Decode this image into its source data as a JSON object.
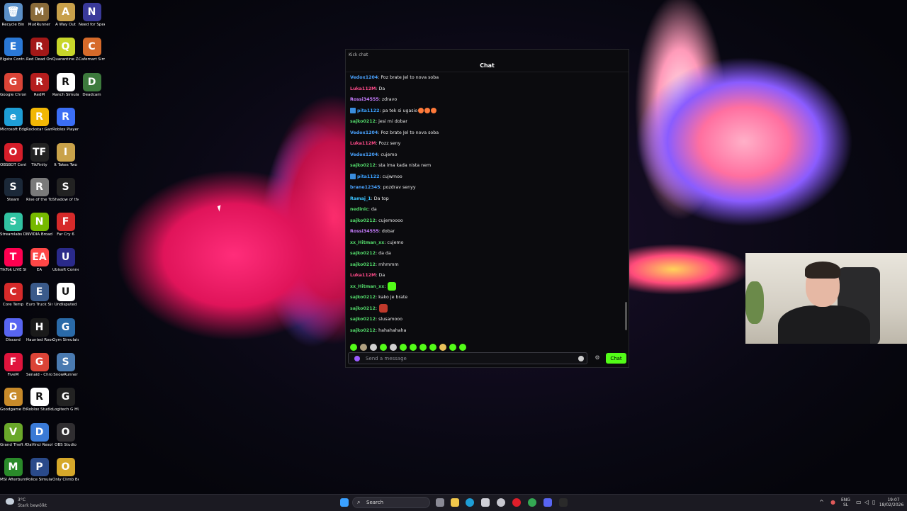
{
  "desktop_icons": [
    {
      "label": "Recycle Bin",
      "icon": "recycle-bin-icon",
      "color": "#5b8fc7",
      "glyph": "🗑"
    },
    {
      "label": "MudRunner",
      "icon": "mudrunner-icon",
      "color": "#8a6b3a",
      "glyph": "M"
    },
    {
      "label": "A Way Out",
      "icon": "a-way-out-icon",
      "color": "#c8a04a",
      "glyph": "A"
    },
    {
      "label": "Need for Speed™ Heat",
      "icon": "nfs-heat-icon",
      "color": "#3a3a9a",
      "glyph": "N"
    },
    {
      "label": "Elgato Contr...",
      "icon": "elgato-icon",
      "color": "#2a78d6",
      "glyph": "E"
    },
    {
      "label": "Red Dead Online",
      "icon": "red-dead-online-icon",
      "color": "#a31818",
      "glyph": "R"
    },
    {
      "label": "Quarantine Zone The...",
      "icon": "quarantine-zone-icon",
      "color": "#c8d62a",
      "glyph": "Q"
    },
    {
      "label": "Cafemart Simulator",
      "icon": "cafemart-icon",
      "color": "#d66a2a",
      "glyph": "C"
    },
    {
      "label": "Google Chrome",
      "icon": "chrome-icon",
      "color": "#db4437",
      "glyph": "G"
    },
    {
      "label": "RedM",
      "icon": "redm-icon",
      "color": "#b51e1e",
      "glyph": "R"
    },
    {
      "label": "Ranch Simulator",
      "icon": "ranch-simulator-icon",
      "color": "#ffffff",
      "glyph": "R"
    },
    {
      "label": "Deadcam",
      "icon": "deadcam-icon",
      "color": "#3d7a3d",
      "glyph": "D"
    },
    {
      "label": "Microsoft Edge",
      "icon": "edge-icon",
      "color": "#1e9ed6",
      "glyph": "e"
    },
    {
      "label": "Rockstar Games ...",
      "icon": "rockstar-icon",
      "color": "#f2b705",
      "glyph": "R"
    },
    {
      "label": "Roblox Player",
      "icon": "roblox-player-icon",
      "color": "#3b6ef5",
      "glyph": "R"
    },
    {
      "label": "",
      "icon": "",
      "color": "",
      "glyph": ""
    },
    {
      "label": "OBSBOT Center",
      "icon": "obsbot-icon",
      "color": "#d61e2a",
      "glyph": "O"
    },
    {
      "label": "TikFinity",
      "icon": "tikfinity-icon",
      "color": "#222222",
      "glyph": "TF"
    },
    {
      "label": "It Takes Two",
      "icon": "it-takes-two-icon",
      "color": "#c9a24a",
      "glyph": "I"
    },
    {
      "label": "",
      "icon": "",
      "color": "",
      "glyph": ""
    },
    {
      "label": "Steam",
      "icon": "steam-icon",
      "color": "#1b2838",
      "glyph": "S"
    },
    {
      "label": "Rise of the Tomb Raider",
      "icon": "tomb-raider-icon",
      "color": "#7a7a7a",
      "glyph": "R"
    },
    {
      "label": "Shadow of the Tom...",
      "icon": "shadow-tomb-raider-icon",
      "color": "#222222",
      "glyph": "S"
    },
    {
      "label": "",
      "icon": "",
      "color": "",
      "glyph": ""
    },
    {
      "label": "Streamlabs Desktop",
      "icon": "streamlabs-icon",
      "color": "#31c3a2",
      "glyph": "S"
    },
    {
      "label": "NVIDIA Broadcast",
      "icon": "nvidia-broadcast-icon",
      "color": "#76b900",
      "glyph": "N"
    },
    {
      "label": "Far Cry 6",
      "icon": "far-cry-6-icon",
      "color": "#d62a2a",
      "glyph": "F"
    },
    {
      "label": "",
      "icon": "",
      "color": "",
      "glyph": ""
    },
    {
      "label": "TikTok LIVE Studio",
      "icon": "tiktok-live-icon",
      "color": "#ff0050",
      "glyph": "T"
    },
    {
      "label": "EA",
      "icon": "ea-icon",
      "color": "#ff4747",
      "glyph": "EA"
    },
    {
      "label": "Ubisoft Connect",
      "icon": "ubisoft-icon",
      "color": "#2a2a8a",
      "glyph": "U"
    },
    {
      "label": "",
      "icon": "",
      "color": "",
      "glyph": ""
    },
    {
      "label": "Core Temp",
      "icon": "core-temp-icon",
      "color": "#d62a2a",
      "glyph": "C"
    },
    {
      "label": "Euro Truck Simulator 2",
      "icon": "euro-truck-icon",
      "color": "#3a5a8a",
      "glyph": "E"
    },
    {
      "label": "Undisputed",
      "icon": "undisputed-icon",
      "color": "#ffffff",
      "glyph": "U"
    },
    {
      "label": "",
      "icon": "",
      "color": "",
      "glyph": ""
    },
    {
      "label": "Discord",
      "icon": "discord-icon",
      "color": "#5865f2",
      "glyph": "D"
    },
    {
      "label": "Haunted Room: 205",
      "icon": "haunted-room-icon",
      "color": "#1a1a1a",
      "glyph": "H"
    },
    {
      "label": "Gym Simulator 24",
      "icon": "gym-simulator-icon",
      "color": "#2a6aa8",
      "glyph": "G"
    },
    {
      "label": "",
      "icon": "",
      "color": "",
      "glyph": ""
    },
    {
      "label": "FiveM",
      "icon": "fivem-icon",
      "color": "#e0143c",
      "glyph": "F"
    },
    {
      "label": "Senaid - Chrome",
      "icon": "chrome-profile-icon",
      "color": "#db4437",
      "glyph": "G"
    },
    {
      "label": "SnowRunner",
      "icon": "snowrunner-icon",
      "color": "#4a7ab0",
      "glyph": "S"
    },
    {
      "label": "",
      "icon": "",
      "color": "",
      "glyph": ""
    },
    {
      "label": "Goodgame Empire",
      "icon": "goodgame-empire-icon",
      "color": "#c88a2a",
      "glyph": "G"
    },
    {
      "label": "Roblox Studio",
      "icon": "roblox-studio-icon",
      "color": "#ffffff",
      "glyph": "R"
    },
    {
      "label": "Logitech G HUB",
      "icon": "logitech-ghub-icon",
      "color": "#222222",
      "glyph": "G"
    },
    {
      "label": "",
      "icon": "",
      "color": "",
      "glyph": ""
    },
    {
      "label": "Grand Theft Auto V Le...",
      "icon": "gta-v-icon",
      "color": "#6aa82a",
      "glyph": "V"
    },
    {
      "label": "DaVinci Resolve",
      "icon": "davinci-icon",
      "color": "#3a7ad6",
      "glyph": "D"
    },
    {
      "label": "OBS Studio",
      "icon": "obs-icon",
      "color": "#302e31",
      "glyph": "O"
    },
    {
      "label": "",
      "icon": "",
      "color": "",
      "glyph": ""
    },
    {
      "label": "MSI Afterburner",
      "icon": "msi-afterburner-icon",
      "color": "#2a8a2a",
      "glyph": "M"
    },
    {
      "label": "Police Simulat...",
      "icon": "police-simulator-icon",
      "color": "#2a4a8a",
      "glyph": "P"
    },
    {
      "label": "Only Climb Better To...",
      "icon": "only-climb-icon",
      "color": "#d6a82a",
      "glyph": "O"
    }
  ],
  "chat_window": {
    "title_bar": "Kick chat",
    "header": "Chat",
    "messages": [
      {
        "user": "Vedox1204",
        "color": "#4aa3ff",
        "text": "Poz brate Jel to nova soba"
      },
      {
        "user": "Luka112M",
        "color": "#ff4b8a",
        "text": "Da"
      },
      {
        "user": "Rossi34555",
        "color": "#c77dff",
        "text": "zdravo"
      },
      {
        "user": "pita1122",
        "color": "#3aa0ff",
        "text": "pa tek si ugasio",
        "badge": true,
        "emotes": 3
      },
      {
        "user": "sajko0212",
        "color": "#53d86a",
        "text": "jesi mi dobar"
      },
      {
        "user": "Vedox1204",
        "color": "#4aa3ff",
        "text": "Poz brate Jel to nova soba"
      },
      {
        "user": "Luka112M",
        "color": "#ff4b8a",
        "text": "Pozz seny"
      },
      {
        "user": "Vedox1204",
        "color": "#4aa3ff",
        "text": "cujemo"
      },
      {
        "user": "sajko0212",
        "color": "#53d86a",
        "text": "sta ima kada nista nem"
      },
      {
        "user": "pita1122",
        "color": "#3aa0ff",
        "text": "cujwmoo",
        "badge": true
      },
      {
        "user": "brane12345",
        "color": "#4aa3ff",
        "text": "pozdrav senyy"
      },
      {
        "user": "Ramaj_1",
        "color": "#3ac3ff",
        "text": "Da top"
      },
      {
        "user": "nedinic",
        "color": "#53d86a",
        "text": "da"
      },
      {
        "user": "sajko0212",
        "color": "#53d86a",
        "text": "cujemoooo"
      },
      {
        "user": "Rossi34555",
        "color": "#c77dff",
        "text": "dobar"
      },
      {
        "user": "xx_Hitman_xx",
        "color": "#53d86a",
        "text": "cujemo"
      },
      {
        "user": "sajko0212",
        "color": "#53d86a",
        "text": "da da"
      },
      {
        "user": "sajko0212",
        "color": "#53d86a",
        "text": "mhmmm"
      },
      {
        "user": "Luka112M",
        "color": "#ff4b8a",
        "text": "Da"
      },
      {
        "user": "xx_Hitman_xx",
        "color": "#53d86a",
        "text": "",
        "emotes": 1
      },
      {
        "user": "sajko0212",
        "color": "#53d86a",
        "text": "kako je brate"
      },
      {
        "user": "sajko0212",
        "color": "#53d86a",
        "text": "",
        "emotes": 1
      },
      {
        "user": "sajko0212",
        "color": "#53d86a",
        "text": "slusamooo"
      },
      {
        "user": "sajko0212",
        "color": "#53d86a",
        "text": "hahahahaha"
      }
    ],
    "emote_colors": [
      "#53fc18",
      "#b0a080",
      "#d0d0d0",
      "#53fc18",
      "#cfcfcf",
      "#53fc18",
      "#53fc18",
      "#53fc18",
      "#53fc18",
      "#e8c15a",
      "#53fc18",
      "#53fc18"
    ],
    "input_placeholder": "Send a message",
    "send_label": "Chat",
    "accent": "#53fc18"
  },
  "taskbar": {
    "weather_temp": "3°C",
    "weather_desc": "Stark bewölkt",
    "search_label": "Search",
    "lang_top": "ENG",
    "lang_bottom": "SL",
    "time": "19:07",
    "date": "18/02/2026"
  }
}
